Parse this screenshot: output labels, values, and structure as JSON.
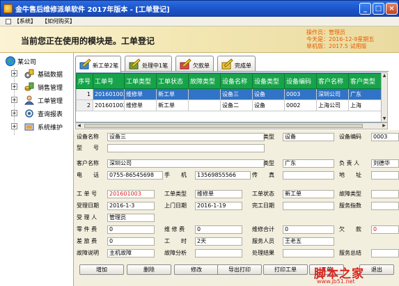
{
  "window": {
    "title": "金牛售后维修派单软件 2017年版本 - [工单登记]"
  },
  "menu": {
    "items": [
      "【系统】",
      "【如何购买】"
    ]
  },
  "module": {
    "title": "当前您正在使用的模块是。工单登记",
    "operator": "操作员：管理员",
    "today": "今天是：2016-12-9星期五",
    "version": "单机版：2017.5 试用版"
  },
  "tree": {
    "root": "某公司",
    "items": [
      "基础数据",
      "销售管理",
      "工单管理",
      "查询报表",
      "系统维护"
    ]
  },
  "tabs": [
    "新工单2笔",
    "处理中1笔",
    "欠款单",
    "完成单"
  ],
  "grid": {
    "headers": [
      "序号",
      "工单号",
      "工单类型",
      "工单状态",
      "故障类型",
      "设备名称",
      "设备类型",
      "设备编码",
      "客户名称",
      "客户类型"
    ],
    "rows": [
      [
        "1",
        "201601003",
        "维修单",
        "新工单",
        "",
        "设备三",
        "设备",
        "0003",
        "深圳公司",
        "广东"
      ],
      [
        "2",
        "201601002",
        "维修单",
        "新工单",
        "",
        "设备二",
        "设备",
        "0002",
        "上海公司",
        "上海"
      ]
    ],
    "selected_row": 0
  },
  "form": {
    "device_name": {
      "label": "设备名称",
      "value": "设备三"
    },
    "category": {
      "label": "类型",
      "value": "设备"
    },
    "device_code": {
      "label": "设备编码",
      "value": "0003"
    },
    "model": {
      "label": "型　　号",
      "value": ""
    },
    "customer_name": {
      "label": "客户名称",
      "value": "深圳公司"
    },
    "customer_type": {
      "label": "类型",
      "value": "广东"
    },
    "person_in_charge": {
      "label": "负 责 人",
      "value": "刘德华"
    },
    "phone": {
      "label": "电　　话",
      "value": "0755-86545698"
    },
    "mobile": {
      "label": "手　　机",
      "value": "13569855566"
    },
    "fax": {
      "label": "传　　真",
      "value": ""
    },
    "address": {
      "label": "地　　址",
      "value": ""
    },
    "order_no": {
      "label": "工 单 号",
      "value": "201601003"
    },
    "order_type": {
      "label": "工单类型",
      "value": "维修单"
    },
    "order_status": {
      "label": "工单状态",
      "value": "新工单"
    },
    "fault_type": {
      "label": "故障类型",
      "value": ""
    },
    "accept_date": {
      "label": "受理日期",
      "value": "2016-1-3"
    },
    "visit_date": {
      "label": "上门日期",
      "value": "2016-1-19"
    },
    "finish_date": {
      "label": "完工日期",
      "value": ""
    },
    "service_index": {
      "label": "服务指数",
      "value": ""
    },
    "receiver": {
      "label": "受 理 人",
      "value": "管理员"
    },
    "parts_fee": {
      "label": "零 件 费",
      "value": "0"
    },
    "repair_fee": {
      "label": "维 修 费",
      "value": "0"
    },
    "repair_total": {
      "label": "维修合计",
      "value": "0"
    },
    "arrears": {
      "label": "欠　　款",
      "value": "0"
    },
    "travel_fee": {
      "label": "差 旅 费",
      "value": "0"
    },
    "work_hours": {
      "label": "工　　时",
      "value": "2天"
    },
    "service_staff": {
      "label": "服务人员",
      "value": "王老五"
    },
    "fault_desc": {
      "label": "故障说明",
      "value": "主机故障"
    },
    "fault_analysis": {
      "label": "故障分析",
      "value": ""
    },
    "result": {
      "label": "处理结果",
      "value": ""
    },
    "service_summary": {
      "label": "服务总结",
      "value": ""
    }
  },
  "buttons": [
    "增加",
    "删除",
    "修改",
    "导出打印",
    "打印工单",
    "工单",
    "退出"
  ],
  "watermark": {
    "main": "脚本之家",
    "url": "www.jb51.net"
  }
}
